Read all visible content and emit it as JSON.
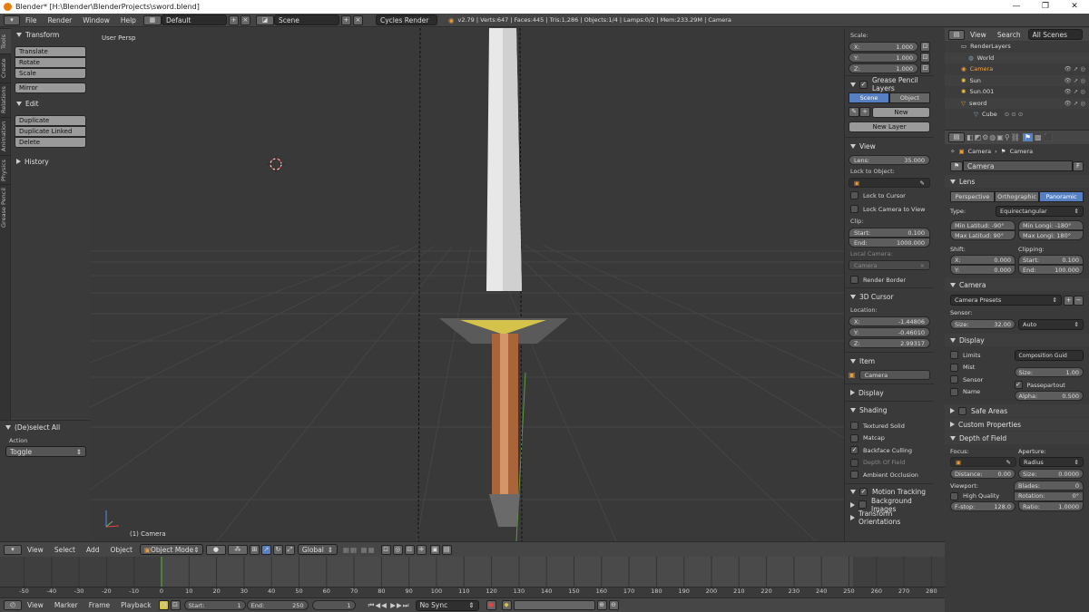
{
  "window": {
    "title": "Blender* [H:\\Blender\\BlenderProjects\\sword.blend]",
    "minimize": "—",
    "maximize": "❐",
    "close": "✕"
  },
  "info_header": {
    "menus": [
      "File",
      "Render",
      "Window",
      "Help"
    ],
    "layout": "Default",
    "scene": "Scene",
    "render_engine": "Cycles Render",
    "stats": "v2.79 | Verts:647 | Faces:445 | Tris:1,286 | Objects:1/4 | Lamps:0/2 | Mem:233.29M | Camera"
  },
  "tool_tabs": [
    "Tools",
    "Create",
    "Relations",
    "Animation",
    "Physics",
    "Grease Pencil"
  ],
  "toolshelf": {
    "transform_title": "Transform",
    "transform_buttons": [
      "Translate",
      "Rotate",
      "Scale"
    ],
    "mirror": "Mirror",
    "edit_title": "Edit",
    "edit_buttons": [
      "Duplicate",
      "Duplicate Linked",
      "Delete"
    ],
    "history_title": "History"
  },
  "last_operator": {
    "title": "(De)select All",
    "action_label": "Action",
    "action_value": "Toggle"
  },
  "viewport": {
    "view_label": "User Persp",
    "object_label": "(1) Camera"
  },
  "npanel": {
    "scale_label": "Scale:",
    "scale": [
      {
        "axis": "X:",
        "value": "1.000"
      },
      {
        "axis": "Y:",
        "value": "1.000"
      },
      {
        "axis": "Z:",
        "value": "1.000"
      }
    ],
    "grease_pencil_title": "Grease Pencil Layers",
    "gp_tabs": [
      "Scene",
      "Object"
    ],
    "gp_new": "New",
    "gp_new_layer": "New Layer",
    "view_title": "View",
    "lens_label": "Lens:",
    "lens_value": "35.000",
    "lock_to_object": "Lock to Object:",
    "lock_to_cursor": "Lock to Cursor",
    "lock_camera_to_view": "Lock Camera to View",
    "clip_label": "Clip:",
    "clip_start_label": "Start:",
    "clip_start": "0.100",
    "clip_end_label": "End:",
    "clip_end": "1000.000",
    "local_camera_label": "Local Camera:",
    "local_camera_value": "Camera",
    "render_border": "Render Border",
    "cursor_title": "3D Cursor",
    "location_label": "Location:",
    "cursor": [
      {
        "axis": "X:",
        "value": "-1.44806"
      },
      {
        "axis": "Y:",
        "value": "-0.46010"
      },
      {
        "axis": "Z:",
        "value": "2.99317"
      }
    ],
    "item_title": "Item",
    "item_name": "Camera",
    "display_title": "Display",
    "shading_title": "Shading",
    "shading_options": [
      {
        "label": "Textured Solid",
        "checked": false
      },
      {
        "label": "Matcap",
        "checked": false
      },
      {
        "label": "Backface Culling",
        "checked": true
      },
      {
        "label": "Depth Of Field",
        "checked": false
      },
      {
        "label": "Ambient Occlusion",
        "checked": false
      }
    ],
    "motion_tracking": "Motion Tracking",
    "background_images": "Background Images",
    "transform_orientations": "Transform Orientations"
  },
  "outliner": {
    "view": "View",
    "search": "Search",
    "filter": "All Scenes",
    "items": [
      "RenderLayers",
      "World",
      "Camera",
      "Sun",
      "Sun.001",
      "sword",
      "Cube"
    ]
  },
  "properties": {
    "breadcrumb": [
      "Camera",
      "Camera"
    ],
    "datablock": "Camera",
    "datablock_f": "F",
    "lens_title": "Lens",
    "lens_types": [
      "Perspective",
      "Orthographic",
      "Panoramic"
    ],
    "type_label": "Type:",
    "type_value": "Equirectangular",
    "min_lat": "Min Latitud: -90°",
    "min_long": "Min Longi: -180°",
    "max_lat": "Max Latitud: 90°",
    "max_long": "Max Longi: 180°",
    "shift_label": "Shift:",
    "clipping_label": "Clipping:",
    "shift_x_label": "X:",
    "shift_x": "0.000",
    "shift_y_label": "Y:",
    "shift_y": "0.000",
    "clip_start_label": "Start:",
    "clip_start": "0.100",
    "clip_end_label": "End:",
    "clip_end": "100.000",
    "camera_title": "Camera",
    "camera_presets": "Camera Presets",
    "sensor_label": "Sensor:",
    "size_label": "Size:",
    "sensor_size": "32.00",
    "sensor_fit": "Auto",
    "display_title": "Display",
    "limits": "Limits",
    "mist": "Mist",
    "sensor": "Sensor",
    "name": "Name",
    "composition_guides": "Composition Guid",
    "disp_size_label": "Size:",
    "disp_size": "1.00",
    "passepartout": "Passepartout",
    "alpha_label": "Alpha:",
    "alpha": "0.500",
    "safe_areas": "Safe Areas",
    "custom_properties": "Custom Properties",
    "dof_title": "Depth of Field",
    "focus_label": "Focus:",
    "aperture_label": "Aperture:",
    "aperture_type": "Radius",
    "distance_label": "Distance:",
    "distance": "0.00",
    "ap_size_label": "Size:",
    "ap_size": "0.0000",
    "viewport_label": "Viewport:",
    "blades_label": "Blades:",
    "blades": "0",
    "high_quality": "High Quality",
    "rotation_label": "Rotation:",
    "rotation": "0°",
    "fstop_label": "F-stop:",
    "fstop": "128.0",
    "ratio_label": "Ratio:",
    "ratio": "1.0000"
  },
  "view3d_header": {
    "menus": [
      "View",
      "Select",
      "Add",
      "Object"
    ],
    "mode": "Object Mode",
    "orientation": "Global"
  },
  "timeline": {
    "ticks": [
      "-50",
      "-40",
      "-30",
      "-20",
      "-10",
      "0",
      "10",
      "20",
      "30",
      "40",
      "50",
      "60",
      "70",
      "80",
      "90",
      "100",
      "110",
      "120",
      "130",
      "140",
      "150",
      "160",
      "170",
      "180",
      "190",
      "200",
      "210",
      "220",
      "230",
      "240",
      "250",
      "260",
      "270",
      "280"
    ],
    "menus": [
      "View",
      "Marker",
      "Frame",
      "Playback"
    ],
    "start_label": "Start:",
    "start": "1",
    "end_label": "End:",
    "end": "250",
    "current": "1",
    "sync": "No Sync"
  }
}
